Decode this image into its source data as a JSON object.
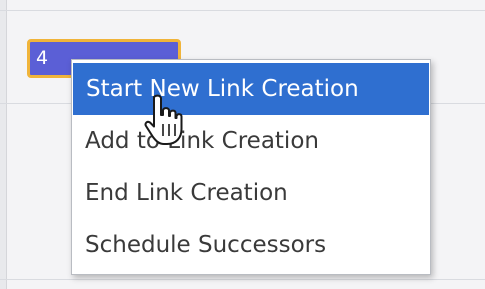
{
  "task_bar": {
    "label": "4",
    "fill_color": "#5b5fd6",
    "selection_outline_color": "#f0b43a"
  },
  "context_menu": {
    "highlight_color": "#2f6fd0",
    "items": [
      {
        "label": "Start New Link Creation",
        "highlighted": true
      },
      {
        "label": "Add to Link Creation",
        "highlighted": false
      },
      {
        "label": "End Link Creation",
        "highlighted": false
      },
      {
        "label": "Schedule Successors",
        "highlighted": false
      }
    ]
  },
  "cursor": {
    "icon": "hand-pointer-icon"
  }
}
